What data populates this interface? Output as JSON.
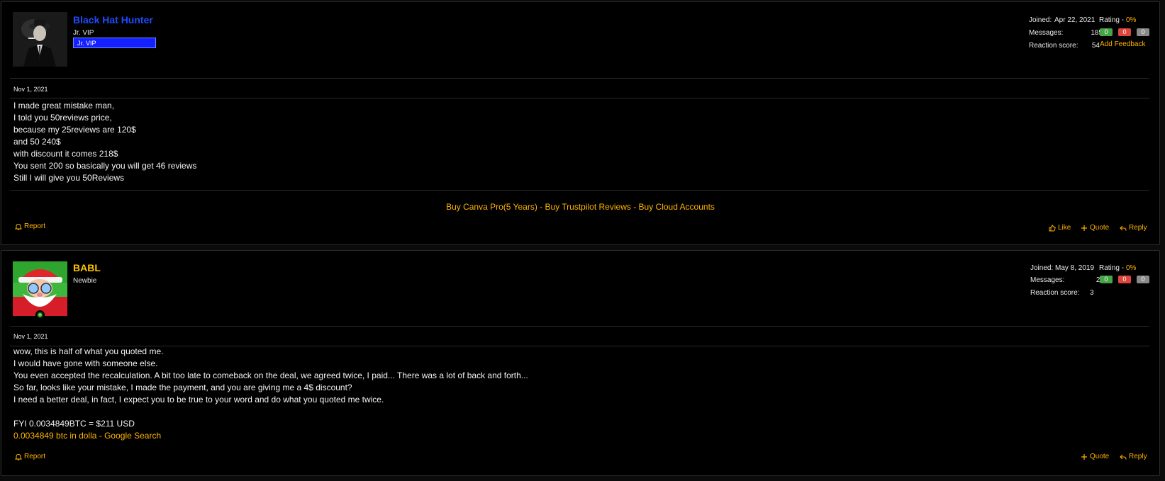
{
  "posts": [
    {
      "author": "Black Hat Hunter",
      "author_color": "#1f4bff",
      "user_title": "Jr. VIP",
      "banner": "Jr. VIP",
      "joined_label": "Joined:",
      "joined": "Apr 22, 2021",
      "rating_label": "Rating -",
      "rating": "0%",
      "messages_label": "Messages:",
      "messages": "185",
      "reaction_label": "Reaction score:",
      "reaction": "54",
      "feedback": {
        "positive": "0",
        "negative": "0",
        "neutral": "0"
      },
      "add_feedback": "Add Feedback",
      "date": "Nov 1, 2021",
      "body": [
        "I made great mistake man,",
        "I told you 50reviews price,",
        "because my 25reviews are 120$",
        "and 50 240$",
        "with discount it comes 218$",
        "You sent 200 so basically you will get 46 reviews",
        "Still I will give you 50Reviews"
      ],
      "signature": "Buy Canva Pro(5 Years) - Buy Trustpilot Reviews - Buy Cloud Accounts",
      "actions": {
        "report": "Report",
        "like": "Like",
        "quote": "Quote",
        "reply": "Reply"
      }
    },
    {
      "author": "BABL",
      "author_color": "#ffc400",
      "user_title": "Newbie",
      "joined_label": "Joined:",
      "joined": "May 8, 2019",
      "rating_label": "Rating -",
      "rating": "0%",
      "messages_label": "Messages:",
      "messages": "23",
      "reaction_label": "Reaction score:",
      "reaction": "3",
      "feedback": {
        "positive": "0",
        "negative": "0",
        "neutral": "0"
      },
      "date": "Nov 1, 2021",
      "body": [
        "wow, this is half of what you quoted me.",
        "I would have gone with someone else.",
        "You even accepted the recalculation. A bit too late to comeback on the deal, we agreed twice, I paid... There was a lot of back and forth...",
        "So far, looks like your mistake, I made the payment, and you are giving me a 4$ discount?",
        "I need a better deal, in fact, I expect you to be true to your word and do what you quoted me twice.",
        "",
        "FYI 0.0034849BTC = $211 USD"
      ],
      "link": "0.0034849 btc in dolla - Google Search",
      "actions": {
        "report": "Report",
        "quote": "Quote",
        "reply": "Reply"
      }
    }
  ]
}
